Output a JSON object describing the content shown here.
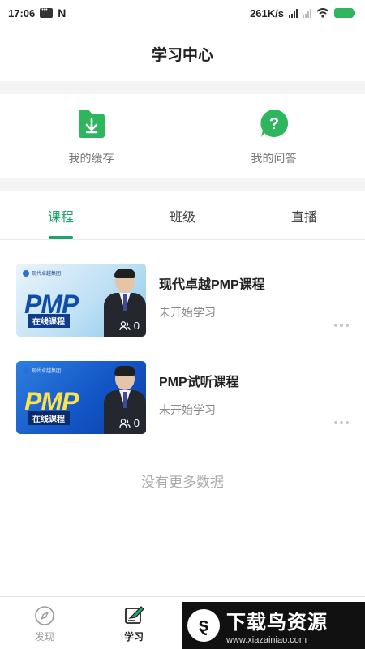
{
  "status_bar": {
    "time": "17:06",
    "n_icon": "N",
    "speed": "261K/s"
  },
  "header": {
    "title": "学习中心"
  },
  "quick_actions": [
    {
      "label": "我的缓存",
      "icon": "download-folder-icon",
      "color": "#2fb55d"
    },
    {
      "label": "我的问答",
      "icon": "question-icon",
      "color": "#2fb55d"
    }
  ],
  "tabs": [
    {
      "label": "课程",
      "active": true
    },
    {
      "label": "班级",
      "active": false
    },
    {
      "label": "直播",
      "active": false
    }
  ],
  "courses": [
    {
      "title": "现代卓越PMP课程",
      "status": "未开始学习",
      "thumb_brand": "现代卓越集团",
      "thumb_title": "PMP",
      "thumb_tag": "在线课程",
      "learners": "0"
    },
    {
      "title": "PMP试听课程",
      "status": "未开始学习",
      "thumb_brand": "现代卓越集团",
      "thumb_title": "PMP",
      "thumb_tag": "在线课程",
      "learners": "0"
    }
  ],
  "empty_hint": "没有更多数据",
  "bottom_nav": [
    {
      "label": "发现",
      "icon": "compass-icon",
      "active": false
    },
    {
      "label": "学习",
      "icon": "study-icon",
      "active": true
    }
  ],
  "watermark": {
    "logo": "ȿ",
    "name": "下载鸟资源",
    "url": "www.xiazainiao.com"
  },
  "colors": {
    "accent": "#1fa36a",
    "icon_green": "#2fb55d",
    "battery": "#2fb55d"
  }
}
